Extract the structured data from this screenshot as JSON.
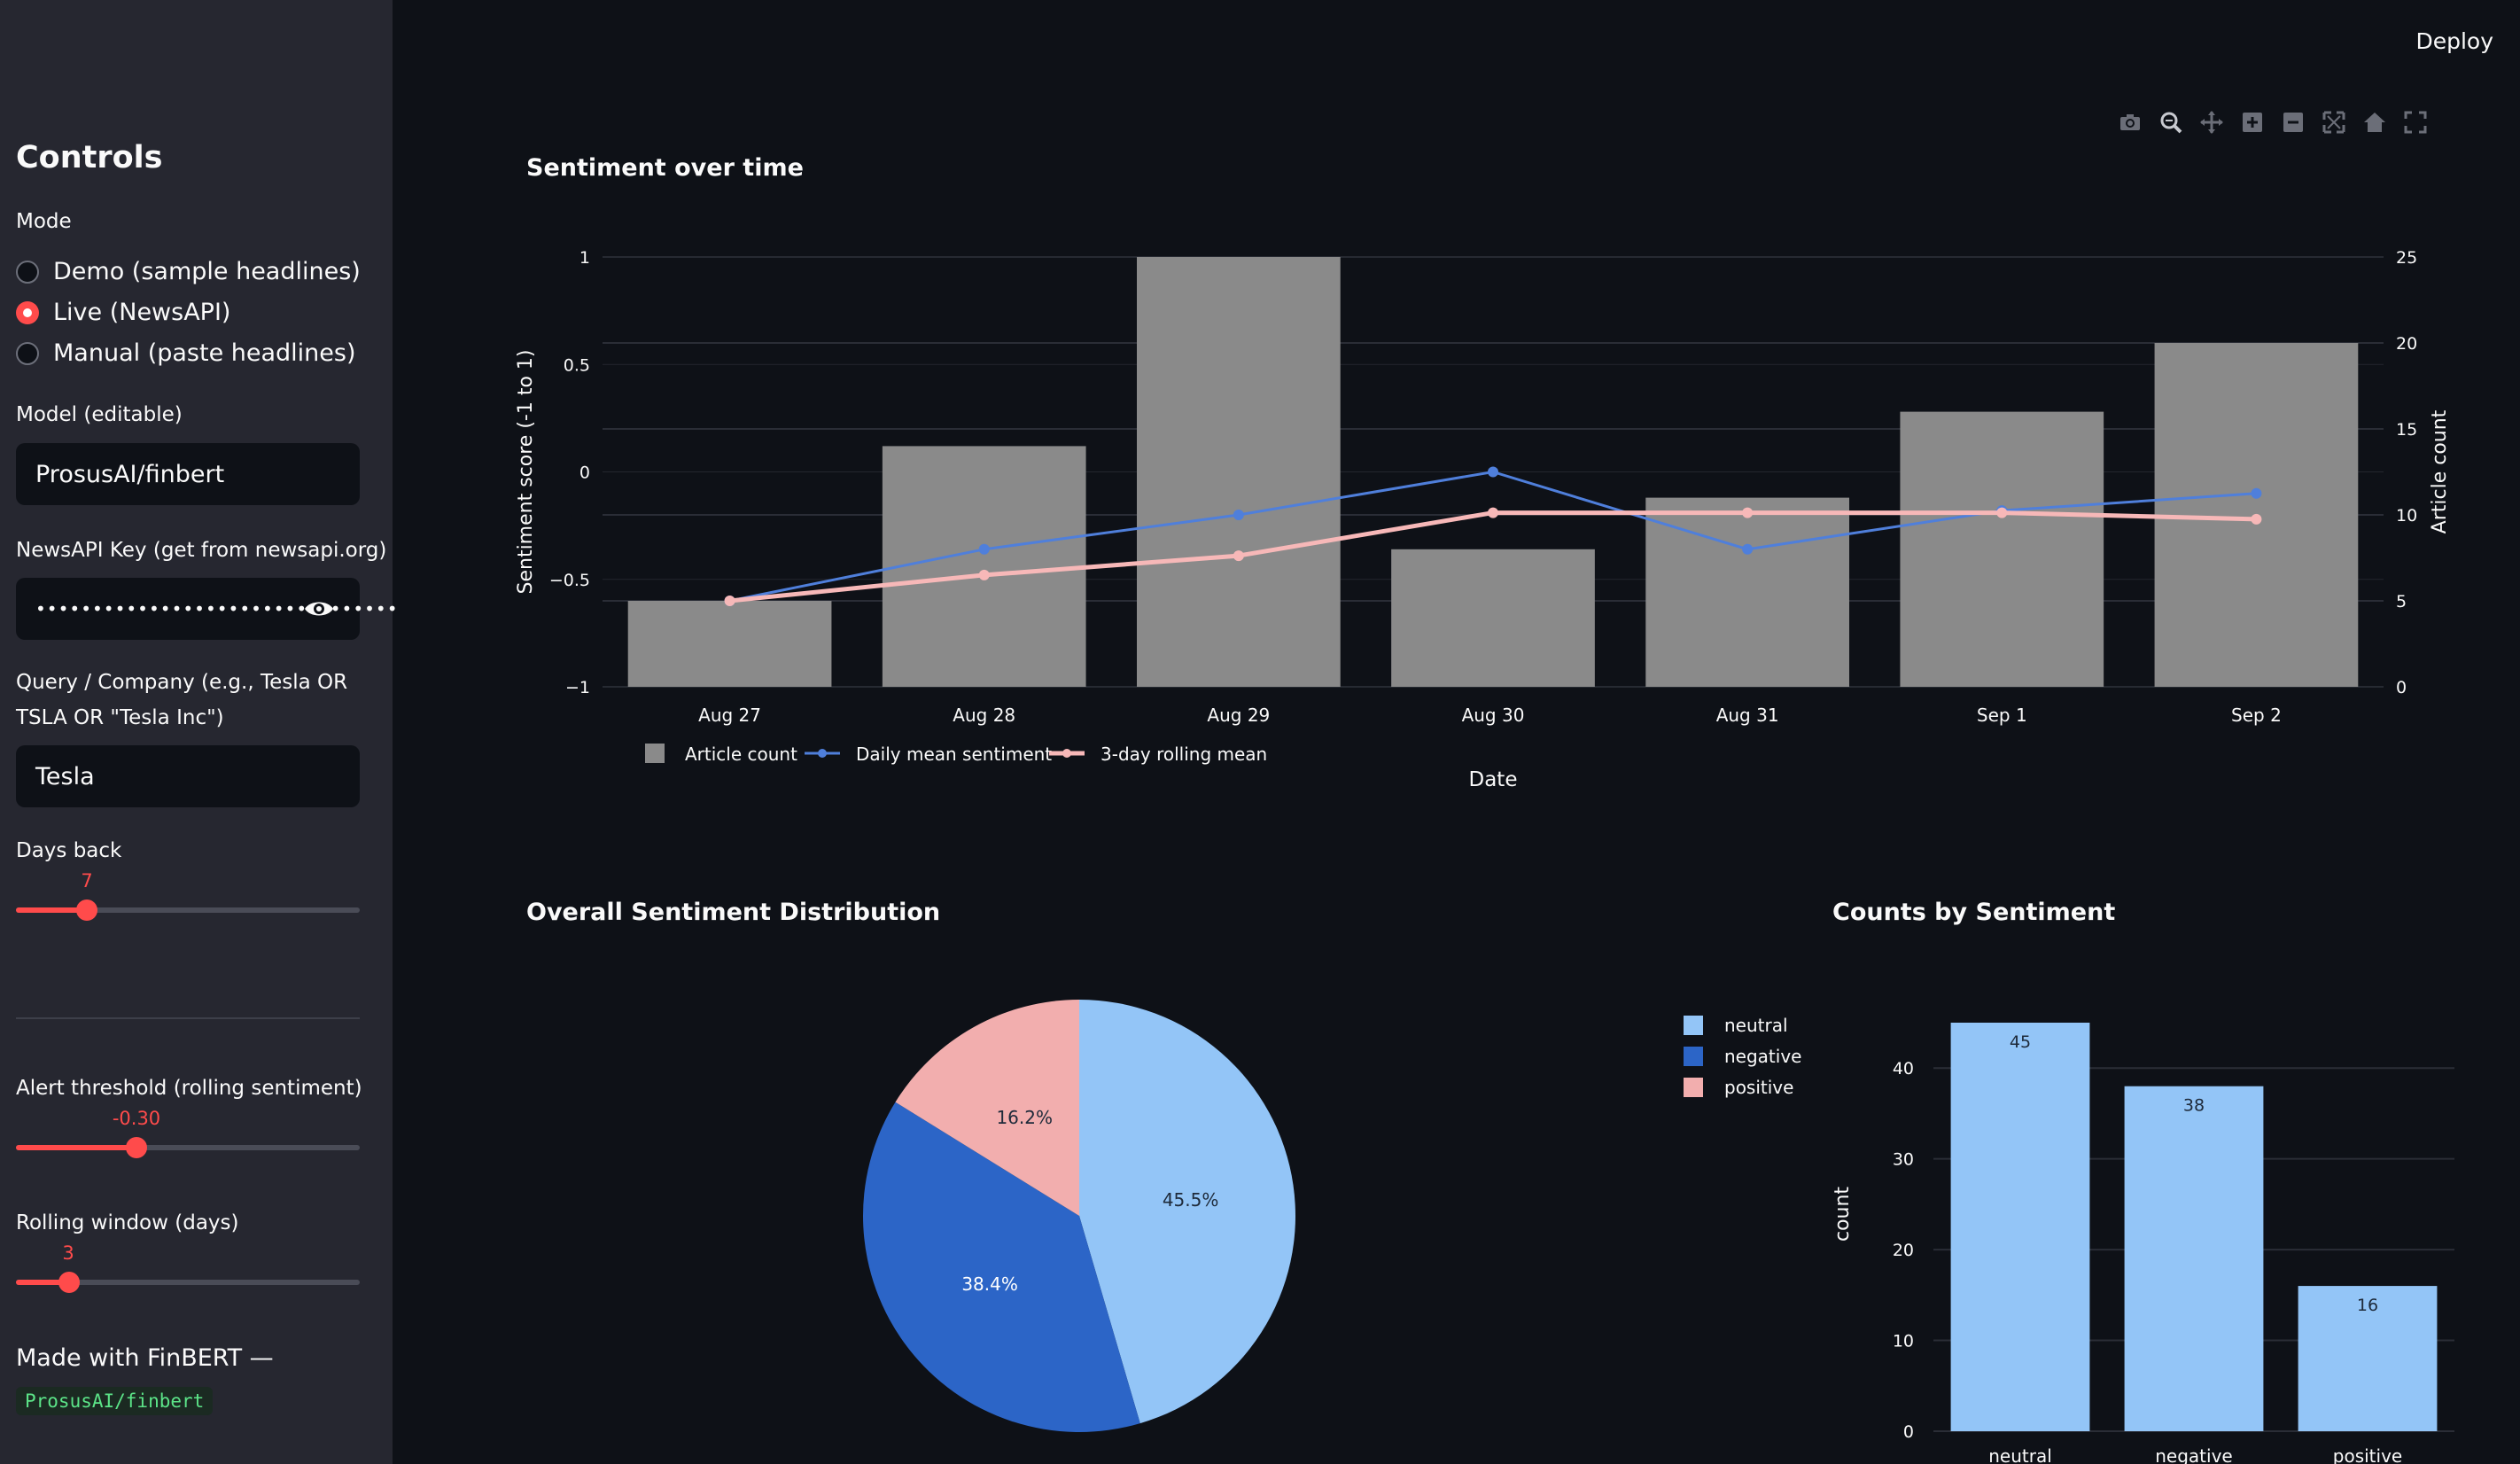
{
  "app": {
    "deploy_label": "Deploy"
  },
  "sidebar": {
    "title": "Controls",
    "mode_label": "Mode",
    "modes": [
      {
        "label": "Demo (sample headlines)",
        "selected": false
      },
      {
        "label": "Live (NewsAPI)",
        "selected": true
      },
      {
        "label": "Manual (paste headlines)",
        "selected": false
      }
    ],
    "model_label": "Model (editable)",
    "model_value": "ProsusAI/finbert",
    "api_key_label": "NewsAPI Key (get from newsapi.org)",
    "api_key_value": "••••••••••••••••••••••••••••••••",
    "query_label_1": "Query / Company (e.g., Tesla OR",
    "query_label_2": "TSLA OR \"Tesla Inc\")",
    "query_value": "Tesla",
    "days_back_label": "Days back",
    "days_back_value": "7",
    "days_back_fraction": 0.21,
    "alert_label": "Alert threshold (rolling sentiment)",
    "alert_value": "-0.30",
    "alert_fraction": 0.35,
    "rolling_label": "Rolling window (days)",
    "rolling_value": "3",
    "rolling_fraction": 0.154,
    "footer_text": "Made with FinBERT —",
    "footer_code": "ProsusAI/finbert"
  },
  "colors": {
    "accent": "#ff4b4b",
    "bar_gray": "#8a8a8a",
    "daily_line": "#4f7fdb",
    "rolling_line": "#f7b8b8",
    "neutral": "#93c5f7",
    "negative": "#2c65c7",
    "positive": "#f2aeae"
  },
  "toolbar_icons": [
    "camera-icon",
    "zoom-icon",
    "pan-icon",
    "zoom-in-icon",
    "zoom-out-icon",
    "autoscale-icon",
    "reset-axes-icon",
    "fullscreen-icon"
  ],
  "chart_data": [
    {
      "type": "bar",
      "title": "Sentiment over time",
      "xlabel": "Date",
      "ylabel": "Sentiment score (-1 to 1)",
      "y2label": "Article count",
      "categories": [
        "Aug 27",
        "Aug 28",
        "Aug 29",
        "Aug 30",
        "Aug 31",
        "Sep 1",
        "Sep 2"
      ],
      "ylim": [
        -1,
        1
      ],
      "y2lim": [
        0,
        25
      ],
      "yticks": [
        "1",
        "0.5",
        "0",
        "−0.5",
        "−1"
      ],
      "y2ticks": [
        "25",
        "20",
        "15",
        "10",
        "5",
        "0"
      ],
      "series": [
        {
          "name": "Article count",
          "kind": "bar",
          "axis": "y2",
          "values": [
            5,
            14,
            25,
            8,
            11,
            16,
            20
          ]
        },
        {
          "name": "Daily mean sentiment",
          "kind": "line",
          "axis": "y",
          "values": [
            -0.6,
            -0.36,
            -0.2,
            0.0,
            -0.36,
            -0.18,
            -0.1
          ]
        },
        {
          "name": "3-day rolling mean",
          "kind": "line",
          "axis": "y",
          "values": [
            -0.6,
            -0.48,
            -0.39,
            -0.19,
            -0.19,
            -0.19,
            -0.22
          ]
        }
      ],
      "legend": "bottom-left",
      "grid": true
    },
    {
      "type": "pie",
      "title": "Overall Sentiment Distribution",
      "slices": [
        {
          "name": "neutral",
          "value": 45.5,
          "label": "45.5%"
        },
        {
          "name": "negative",
          "value": 38.4,
          "label": "38.4%"
        },
        {
          "name": "positive",
          "value": 16.2,
          "label": "16.2%"
        }
      ],
      "legend": "right"
    },
    {
      "type": "bar",
      "title": "Counts by Sentiment",
      "ylabel": "count",
      "categories": [
        "neutral",
        "negative",
        "positive"
      ],
      "values": [
        45,
        38,
        16
      ],
      "ylim": [
        0,
        45
      ],
      "yticks": [
        "40",
        "30",
        "20",
        "10",
        "0"
      ],
      "grid": true
    }
  ]
}
